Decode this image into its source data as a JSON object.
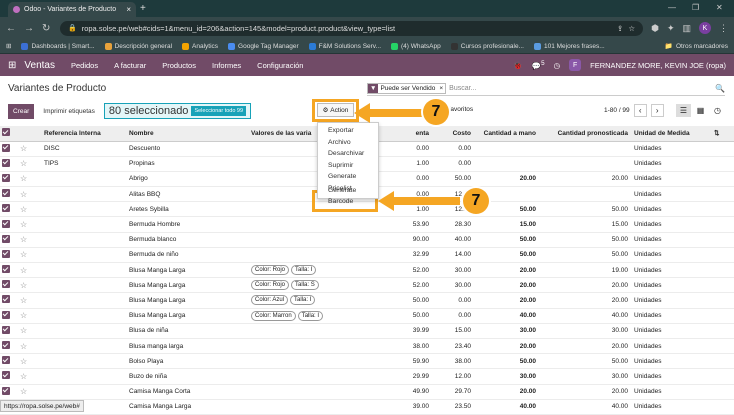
{
  "browser": {
    "tab_title": "Odoo - Variantes de Producto",
    "url": "ropa.solse.pe/web#cids=1&menu_id=206&action=145&model=product.product&view_type=list",
    "profile": "K"
  },
  "bookmarks": [
    {
      "label": "Dashboards | Smart...",
      "color": "#3b6fd4"
    },
    {
      "label": "Descripción general",
      "color": "#e8a23b"
    },
    {
      "label": "Analytics",
      "color": "#f4a300"
    },
    {
      "label": "Google Tag Manager",
      "color": "#4a8cf0"
    },
    {
      "label": "F&M Solutions Serv...",
      "color": "#2b7bd6"
    },
    {
      "label": "(4) WhatsApp",
      "color": "#25d366"
    },
    {
      "label": "Cursos profesionale...",
      "color": "#333"
    },
    {
      "label": "101 Mejores frases...",
      "color": "#5a9be0"
    }
  ],
  "bookmarks_other": "Otros marcadores",
  "topnav": {
    "app": "Ventas",
    "menus": [
      "Pedidos",
      "A facturar",
      "Productos",
      "Informes",
      "Configuración"
    ],
    "chat_count": "5",
    "user": "FERNANDEZ MORE, KEVIN JOE (ropa)",
    "user_initial": "F"
  },
  "breadcrumb": "Variantes de Producto",
  "search": {
    "facet": "Puede ser Vendido",
    "placeholder": "Buscar..."
  },
  "buttons": {
    "create": "Crear",
    "print_labels": "Imprimir etiquetas",
    "selected": "80 seleccionado",
    "select_all": "Seleccionar todo 99",
    "action": "Action",
    "favorites": "Favoritos",
    "filter_partial": "or"
  },
  "pager": {
    "range": "1-80 / 99"
  },
  "columns": [
    "Referencia Interna",
    "Nombre",
    "Valores de las varia",
    "enta",
    "Costo",
    "Cantidad a mano",
    "Cantidad pronosticada",
    "Unidad de Medida"
  ],
  "rows": [
    {
      "ref": "DISC",
      "name": "Descuento",
      "tags": [],
      "price": "0.00",
      "cost": "0.00",
      "onhand": "",
      "forecast": "",
      "uom": "Unidades"
    },
    {
      "ref": "TIPS",
      "name": "Propinas",
      "tags": [],
      "price": "1.00",
      "cost": "0.00",
      "onhand": "",
      "forecast": "",
      "uom": "Unidades"
    },
    {
      "ref": "",
      "name": "Abrigo",
      "tags": [],
      "price": "0.00",
      "cost": "50.00",
      "onhand": "20.00",
      "forecast": "20.00",
      "uom": "Unidades"
    },
    {
      "ref": "",
      "name": "Alitas BBQ",
      "tags": [],
      "price": "0.00",
      "cost": "12.00",
      "onhand": "",
      "forecast": "",
      "uom": "Unidades"
    },
    {
      "ref": "",
      "name": "Aretes Sybilla",
      "tags": [],
      "price": "1.00",
      "cost": "12.00",
      "onhand": "50.00",
      "forecast": "50.00",
      "uom": "Unidades"
    },
    {
      "ref": "",
      "name": "Bermuda Hombre",
      "tags": [],
      "price": "53.90",
      "cost": "28.30",
      "onhand": "15.00",
      "forecast": "15.00",
      "uom": "Unidades"
    },
    {
      "ref": "",
      "name": "Bermuda blanco",
      "tags": [],
      "price": "90.00",
      "cost": "40.00",
      "onhand": "50.00",
      "forecast": "50.00",
      "uom": "Unidades"
    },
    {
      "ref": "",
      "name": "Bermuda de niño",
      "tags": [],
      "price": "32.99",
      "cost": "14.00",
      "onhand": "50.00",
      "forecast": "50.00",
      "uom": "Unidades"
    },
    {
      "ref": "",
      "name": "Blusa Manga Larga",
      "tags": [
        "Color: Rojo",
        "Talla: I"
      ],
      "price": "52.00",
      "cost": "30.00",
      "onhand": "20.00",
      "forecast": "19.00",
      "uom": "Unidades"
    },
    {
      "ref": "",
      "name": "Blusa Manga Larga",
      "tags": [
        "Color: Rojo",
        "Talla: S"
      ],
      "price": "52.00",
      "cost": "30.00",
      "onhand": "20.00",
      "forecast": "20.00",
      "uom": "Unidades"
    },
    {
      "ref": "",
      "name": "Blusa Manga Larga",
      "tags": [
        "Color: Azul",
        "Talla: I"
      ],
      "price": "50.00",
      "cost": "0.00",
      "onhand": "20.00",
      "forecast": "20.00",
      "uom": "Unidades"
    },
    {
      "ref": "",
      "name": "Blusa Manga Larga",
      "tags": [
        "Color: Marron",
        "Talla: I"
      ],
      "price": "50.00",
      "cost": "0.00",
      "onhand": "40.00",
      "forecast": "40.00",
      "uom": "Unidades"
    },
    {
      "ref": "",
      "name": "Blusa de niña",
      "tags": [],
      "price": "39.99",
      "cost": "15.00",
      "onhand": "30.00",
      "forecast": "30.00",
      "uom": "Unidades"
    },
    {
      "ref": "",
      "name": "Blusa manga larga",
      "tags": [],
      "price": "38.00",
      "cost": "23.40",
      "onhand": "20.00",
      "forecast": "20.00",
      "uom": "Unidades"
    },
    {
      "ref": "",
      "name": "Bolso Playa",
      "tags": [],
      "price": "59.90",
      "cost": "38.00",
      "onhand": "50.00",
      "forecast": "50.00",
      "uom": "Unidades"
    },
    {
      "ref": "",
      "name": "Buzo de niña",
      "tags": [],
      "price": "29.99",
      "cost": "12.00",
      "onhand": "30.00",
      "forecast": "30.00",
      "uom": "Unidades"
    },
    {
      "ref": "",
      "name": "Camisa Manga Corta",
      "tags": [],
      "price": "49.90",
      "cost": "29.70",
      "onhand": "20.00",
      "forecast": "20.00",
      "uom": "Unidades"
    },
    {
      "ref": "",
      "name": "Camisa Manga Larga",
      "tags": [],
      "price": "39.00",
      "cost": "23.50",
      "onhand": "40.00",
      "forecast": "40.00",
      "uom": "Unidades"
    }
  ],
  "action_menu": [
    "Exportar",
    "Archivo",
    "Desarchivar",
    "Suprimir",
    "Generate Pricelist",
    "Generate Barcode"
  ],
  "step_badges": [
    "7",
    "7"
  ],
  "highlight_color": "#f5a623",
  "status_url": "https://ropa.solse.pe/web#"
}
